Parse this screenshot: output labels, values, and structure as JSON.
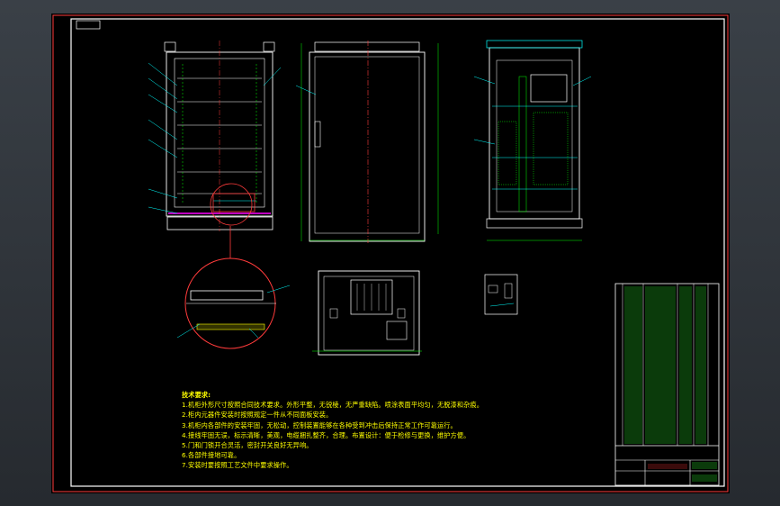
{
  "app": {
    "type": "cad-drawing-viewer"
  },
  "notes": {
    "title": "技术要求:",
    "items": [
      "1.机柜外形尺寸按照合同技术要求。外形平整，无锐棱，无严重缺陷。喷涂表面平均匀，无脱漆和杂痕。",
      "2.柜内元器件安装时按照规定一件从不同面板安装。",
      "3.机柜内各部件的安装牢固，无松动，控制装置能够在各种受到冲击后保持正常工作可靠运行。",
      "4.接线牢固无误，标示清晰，美观，电缆捆扎整齐，合理。布置设计：便于检修与更换，维护方便。",
      "5.门和门锁开合灵活，密封开关良好无异响。",
      "6.各部件接地可靠。",
      "7.安装时要按照工艺文件中要求操作。"
    ]
  },
  "colors": {
    "background": "#000000",
    "outline": "#ffffff",
    "accent": "#00ffff",
    "dimension": "#00ff00",
    "detail": "#ff0000",
    "magenta": "#ff00ff",
    "text": "#ffff00"
  }
}
